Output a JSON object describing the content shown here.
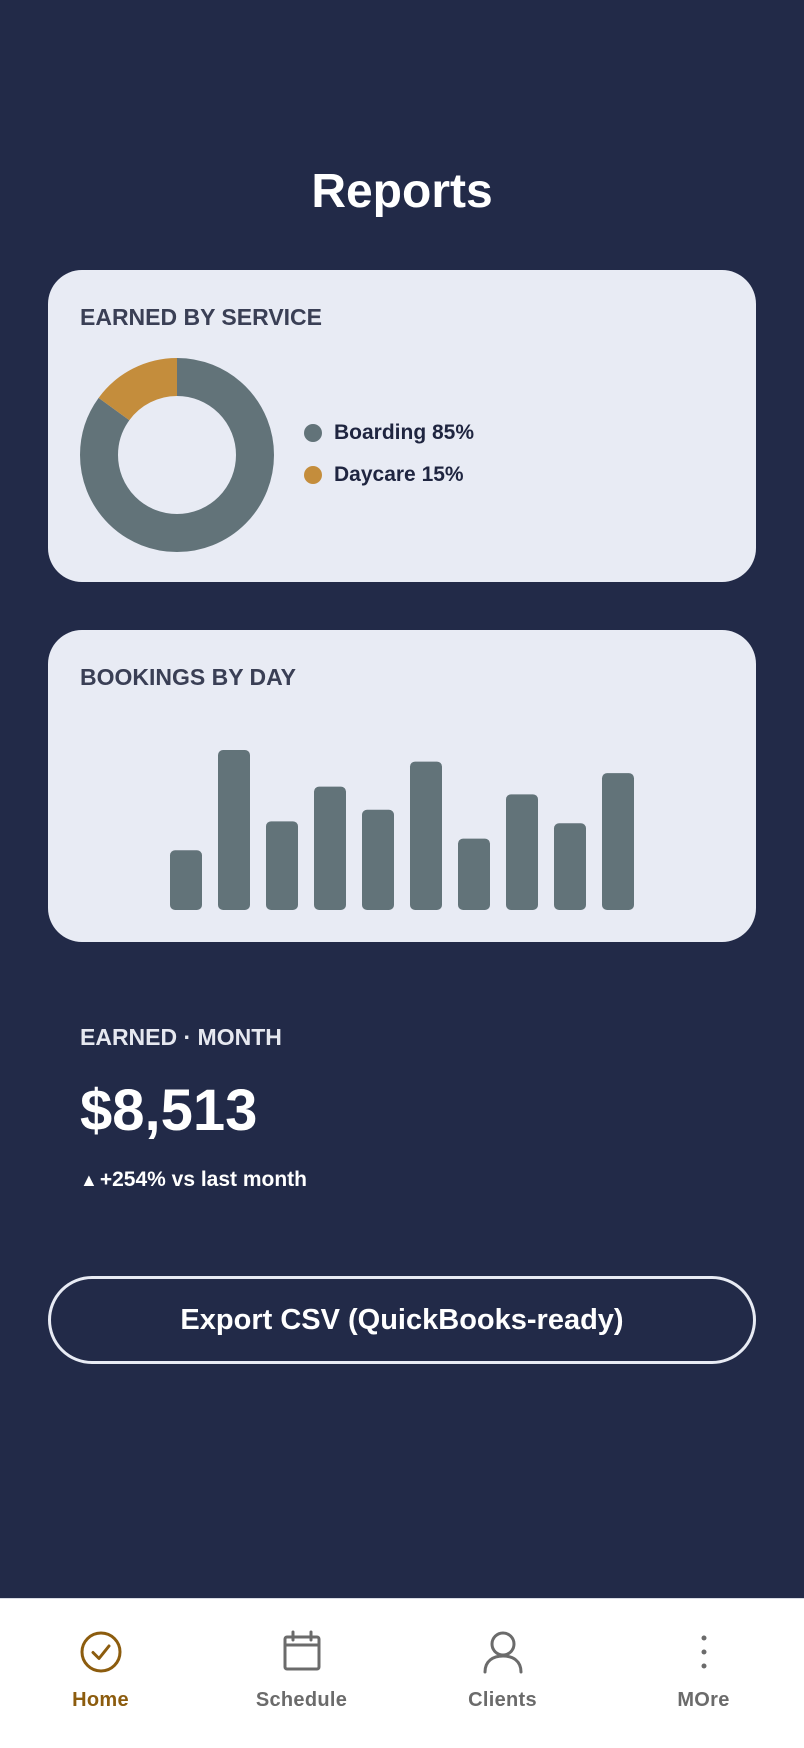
{
  "page": {
    "title": "Reports"
  },
  "service_card": {
    "title": "EARNED BY SERVICE",
    "legend": [
      {
        "label": "Boarding 85%",
        "color": "#627379"
      },
      {
        "label": "Daycare 15%",
        "color": "#c48d3c"
      }
    ]
  },
  "bookings_card": {
    "title": "BOOKINGS BY DAY"
  },
  "earned": {
    "label": "EARNED · MONTH",
    "value": "$8,513",
    "change_arrow": "▲",
    "change": "+254% vs last month"
  },
  "export_button": {
    "label": "Export CSV (QuickBooks-ready)"
  },
  "nav": {
    "items": [
      {
        "label": "Home",
        "icon": "check-circle-icon",
        "active": true
      },
      {
        "label": "Schedule",
        "icon": "calendar-icon",
        "active": false
      },
      {
        "label": "Clients",
        "icon": "person-icon",
        "active": false
      },
      {
        "label": "MOre",
        "icon": "more-vertical-icon",
        "active": false
      }
    ]
  },
  "colors": {
    "background": "#222a48",
    "card": "#e8ebf4",
    "bar": "#627379",
    "accent": "#c48d3c",
    "nav_active": "#8c5c0e"
  },
  "chart_data": [
    {
      "type": "pie",
      "title": "EARNED BY SERVICE",
      "categories": [
        "Boarding",
        "Daycare"
      ],
      "values": [
        85,
        15
      ],
      "colors": [
        "#627379",
        "#c48d3c"
      ],
      "donut": true
    },
    {
      "type": "bar",
      "title": "BOOKINGS BY DAY",
      "values": [
        3.1,
        8.3,
        4.6,
        6.4,
        5.2,
        7.7,
        3.7,
        6.0,
        4.5,
        7.1
      ],
      "ylim": [
        0,
        8.3
      ],
      "grid": false
    }
  ]
}
